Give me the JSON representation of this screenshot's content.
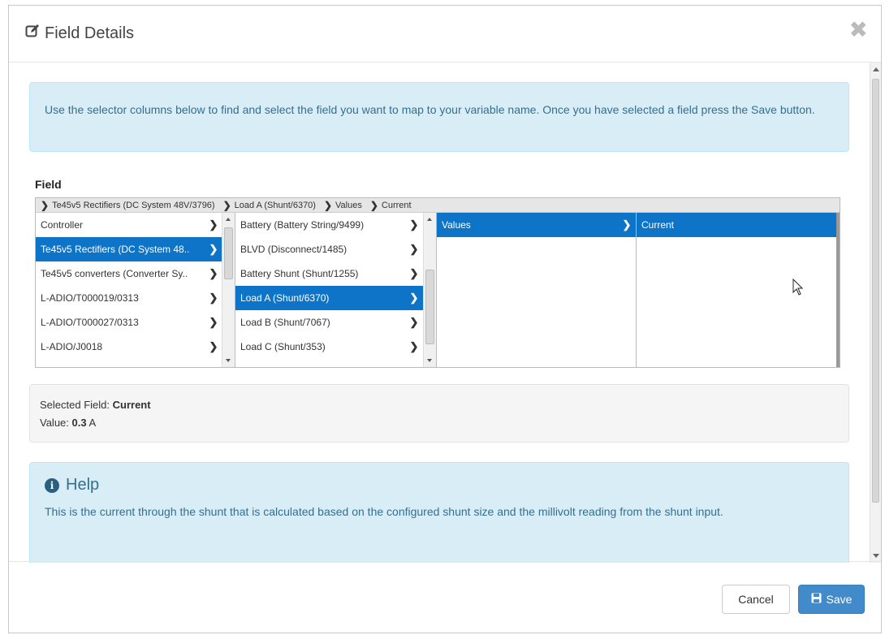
{
  "dialog": {
    "title": "Field Details",
    "close_symbol": "✖"
  },
  "info": {
    "text": "Use the selector columns below to find and select the field you want to map to your variable name. Once you have selected a field press the Save button."
  },
  "field": {
    "label": "Field",
    "breadcrumb": [
      "Te45v5 Rectifiers (DC System 48V/3796)",
      "Load A (Shunt/6370)",
      "Values",
      "Current"
    ],
    "columns": [
      {
        "items": [
          {
            "label": "Controller",
            "selected": false
          },
          {
            "label": "Te45v5 Rectifiers (DC System 48..",
            "selected": true
          },
          {
            "label": "Te45v5 converters (Converter Sy..",
            "selected": false
          },
          {
            "label": "L-ADIO/T000019/0313",
            "selected": false
          },
          {
            "label": "L-ADIO/T000027/0313",
            "selected": false
          },
          {
            "label": "L-ADIO/J0018",
            "selected": false
          }
        ]
      },
      {
        "items": [
          {
            "label": "Battery (Battery String/9499)",
            "selected": false
          },
          {
            "label": "BLVD (Disconnect/1485)",
            "selected": false
          },
          {
            "label": "Battery Shunt (Shunt/1255)",
            "selected": false
          },
          {
            "label": "Load A (Shunt/6370)",
            "selected": true
          },
          {
            "label": "Load B (Shunt/7067)",
            "selected": false
          },
          {
            "label": "Load C (Shunt/353)",
            "selected": false
          }
        ]
      },
      {
        "items": [
          {
            "label": "Values",
            "selected": true
          }
        ]
      },
      {
        "items": [
          {
            "label": "Current",
            "selected": true
          }
        ]
      }
    ]
  },
  "selected": {
    "field_prefix": "Selected Field:",
    "field_value": "Current",
    "value_prefix": "Value:",
    "value_number": "0.3",
    "value_unit": "A"
  },
  "help": {
    "title": "Help",
    "text": "This is the current through the shunt that is calculated based on the configured shunt size and the millivolt reading from the shunt input."
  },
  "footer": {
    "cancel_label": "Cancel",
    "save_label": "Save"
  },
  "colors": {
    "selected": "#0e74c8",
    "info_bg": "#d9edf7",
    "info_text": "#31708f",
    "save_button": "#428bca"
  },
  "icons": [
    "edit-icon",
    "close-icon",
    "chevron-right-icon",
    "info-circle-icon",
    "save-icon",
    "mouse-cursor-icon"
  ]
}
